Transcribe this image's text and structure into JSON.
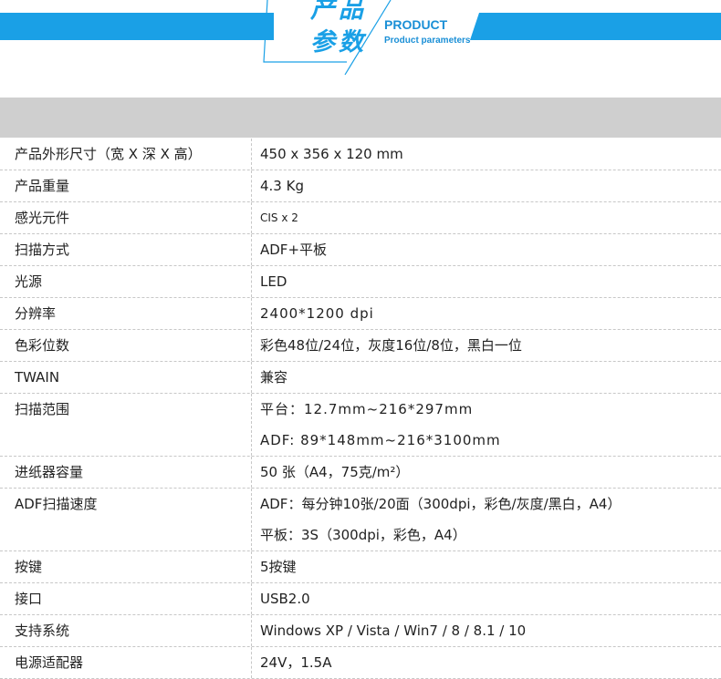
{
  "header": {
    "title_cn_line1": "产品",
    "title_cn_line2": "参数",
    "title_en": "PRODUCT",
    "title_en_sub": "Product parameters",
    "accent_color": "#1aa0e6"
  },
  "specs": [
    {
      "label": "产品外形尺寸（宽 X 深 X 高）",
      "values": [
        "450 x 356 x 120 mm"
      ]
    },
    {
      "label": "产品重量",
      "values": [
        "4.3 Kg"
      ]
    },
    {
      "label": "感光元件",
      "values": [
        "CIS x 2"
      ]
    },
    {
      "label": "扫描方式",
      "values": [
        "ADF+平板"
      ]
    },
    {
      "label": "光源",
      "values": [
        "LED"
      ]
    },
    {
      "label": "分辨率",
      "values": [
        "2400*1200 dpi"
      ]
    },
    {
      "label": "色彩位数",
      "values": [
        "彩色48位/24位，灰度16位/8位，黑白一位"
      ]
    },
    {
      "label": "TWAIN",
      "values": [
        "兼容"
      ]
    },
    {
      "label": "扫描范围",
      "values": [
        "平台：12.7mm~216*297mm",
        "ADF:  89*148mm~216*3100mm"
      ]
    },
    {
      "label": "进纸器容量",
      "values": [
        "50 张（A4，75克/m²）"
      ]
    },
    {
      "label": "ADF扫描速度",
      "values": [
        "ADF：每分钟10张/20面（300dpi，彩色/灰度/黑白，A4）",
        "平板：3S（300dpi，彩色，A4）"
      ]
    },
    {
      "label": "按键",
      "values": [
        "5按键"
      ]
    },
    {
      "label": "接口",
      "values": [
        "USB2.0"
      ]
    },
    {
      "label": "支持系统",
      "values": [
        "Windows XP / Vista / Win7 / 8 / 8.1 / 10"
      ]
    },
    {
      "label": "电源适配器",
      "values": [
        "24V，1.5A"
      ]
    }
  ]
}
